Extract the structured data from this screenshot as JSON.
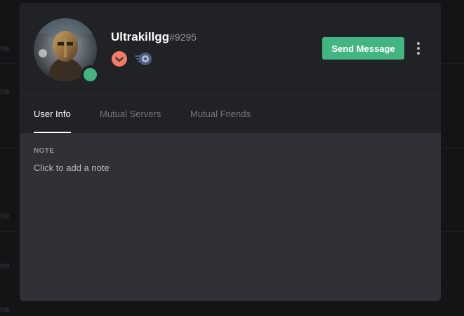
{
  "background": {
    "cutoff_fragments": [
      "ne",
      "ne",
      "ne",
      "ne",
      "ne"
    ]
  },
  "profile": {
    "username": "Ultrakillgg",
    "discriminator": "#9295",
    "status": "online",
    "status_color": "#43b581",
    "badges": [
      {
        "icon": "hypesquad-brilliance-badge-icon",
        "color": "#f47b67"
      },
      {
        "icon": "nitro-badge-icon",
        "color": "#4f5d7e"
      }
    ]
  },
  "actions": {
    "send_message_label": "Send Message",
    "more_icon": "more-vertical-icon"
  },
  "tabs": [
    {
      "label": "User Info",
      "active": true
    },
    {
      "label": "Mutual Servers",
      "active": false
    },
    {
      "label": "Mutual Friends",
      "active": false
    }
  ],
  "note": {
    "label": "NOTE",
    "placeholder": "Click to add a note"
  },
  "colors": {
    "accent": "#43b581",
    "header_bg": "#202225",
    "body_bg": "#2f3136"
  }
}
